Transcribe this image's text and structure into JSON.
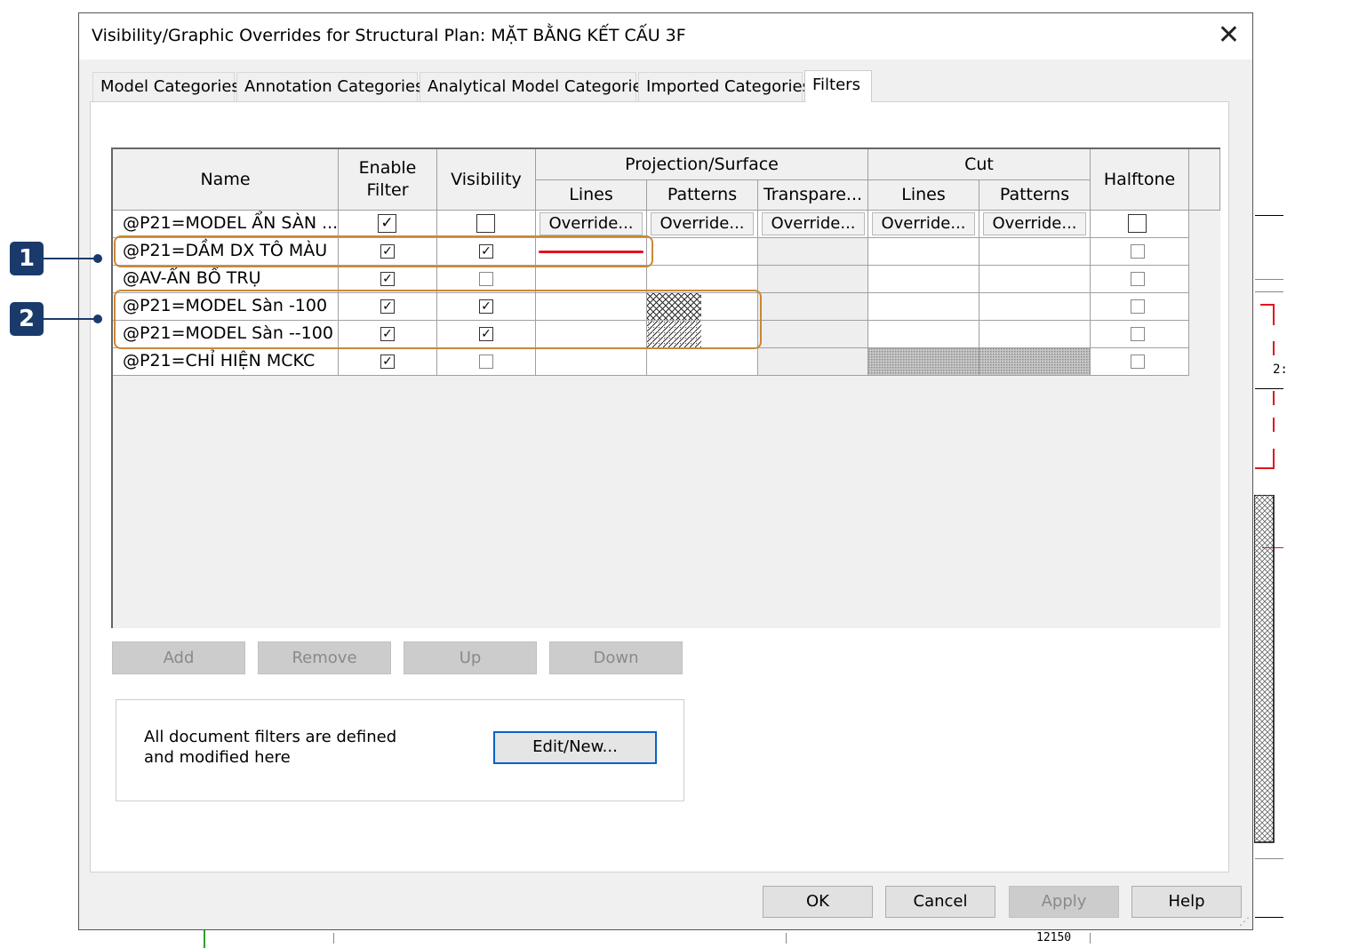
{
  "dialog": {
    "title": "Visibility/Graphic Overrides for Structural Plan: MẶT BẰNG KẾT CẤU 3F",
    "close_glyph": "✕"
  },
  "tabs": [
    {
      "label": "Model Categories"
    },
    {
      "label": "Annotation Categories"
    },
    {
      "label": "Analytical Model Categories"
    },
    {
      "label": "Imported Categories"
    },
    {
      "label": "Filters",
      "active": true
    }
  ],
  "grid": {
    "headers": {
      "name": "Name",
      "enable_filter": "Enable Filter",
      "visibility": "Visibility",
      "projection_surface": "Projection/Surface",
      "proj_lines": "Lines",
      "proj_patterns": "Patterns",
      "proj_transparency": "Transpare...",
      "cut": "Cut",
      "cut_lines": "Lines",
      "cut_patterns": "Patterns",
      "halftone": "Halftone"
    },
    "override_label": "Override...",
    "rows": [
      {
        "name": "@P21=MODEL ẨN SÀN ...",
        "enable_filter": true,
        "visibility": false,
        "halftone": false
      },
      {
        "name": "@P21=DẦM DX TÔ MÀU",
        "enable_filter": true,
        "visibility": true,
        "halftone": false
      },
      {
        "name": "@AV-ẨN BỐ TRỤ",
        "enable_filter": true,
        "visibility": false,
        "halftone": false
      },
      {
        "name": "@P21=MODEL Sàn -100",
        "enable_filter": true,
        "visibility": true,
        "halftone": false
      },
      {
        "name": "@P21=MODEL Sàn --100",
        "enable_filter": true,
        "visibility": true,
        "halftone": false
      },
      {
        "name": "@P21=CHỈ HIỆN MCKC",
        "enable_filter": true,
        "visibility": false,
        "halftone": false
      }
    ]
  },
  "buttons": {
    "add": "Add",
    "remove": "Remove",
    "up": "Up",
    "down": "Down",
    "edit_new": "Edit/New...",
    "ok": "OK",
    "cancel": "Cancel",
    "apply": "Apply",
    "help": "Help"
  },
  "info_text": "All document filters are defined and modified here",
  "annotations": {
    "badge_1": "1",
    "badge_2": "2",
    "color": "#c8883a",
    "badge_color": "#1a3a6b"
  },
  "colors": {
    "line_override": "#e0141e",
    "edit_focus": "#0b62c4"
  },
  "background": {
    "dimension_text": "12150",
    "side_text": "2:"
  }
}
